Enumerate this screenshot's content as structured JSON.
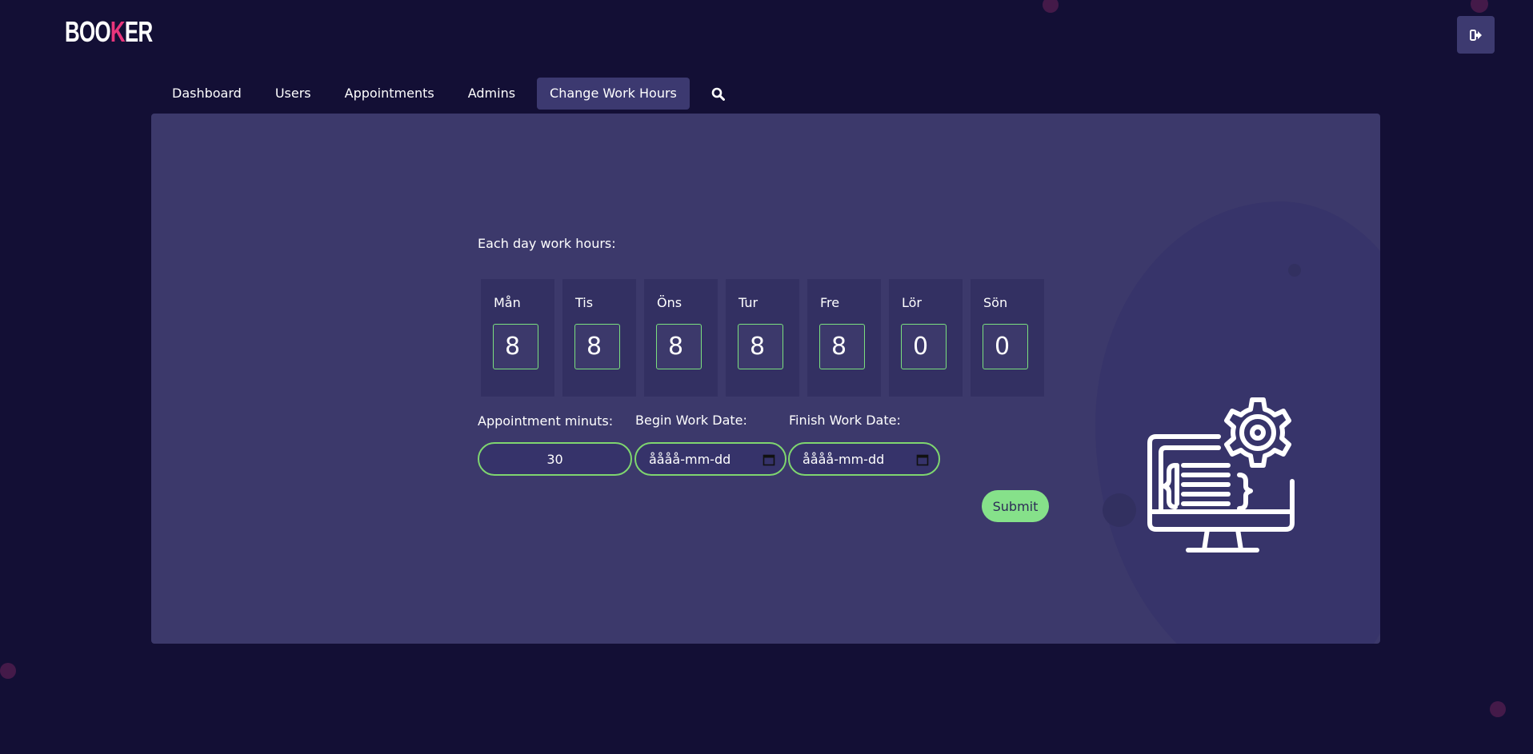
{
  "logo": {
    "pre": "BOO",
    "mid": "K",
    "post": "ER"
  },
  "nav": {
    "items": [
      "Dashboard",
      "Users",
      "Appointments",
      "Admins",
      "Change Work Hours"
    ],
    "active": "Change Work Hours",
    "search_icon": "search-icon"
  },
  "header": {
    "logout_icon": "sign-out-icon"
  },
  "form": {
    "work_hours_label": "Each day work hours:",
    "days": [
      {
        "name": "Mån",
        "value": "8"
      },
      {
        "name": "Tis",
        "value": "8"
      },
      {
        "name": "Öns",
        "value": "8"
      },
      {
        "name": "Tur",
        "value": "8"
      },
      {
        "name": "Fre",
        "value": "8"
      },
      {
        "name": "Lör",
        "value": "0"
      },
      {
        "name": "Sön",
        "value": "0"
      }
    ],
    "appointment_label": "Appointment minuts:",
    "appointment_value": "30",
    "begin_label": "Begin Work Date:",
    "begin_value": "åååå-mm-dd",
    "finish_label": "Finish Work Date:",
    "finish_value": "åååå-mm-dd",
    "submit_label": "Submit"
  },
  "colors": {
    "background": "#130f35",
    "panel": "#3c396b",
    "accent": "#7fd66f",
    "logo_accent": "#e8357b"
  }
}
